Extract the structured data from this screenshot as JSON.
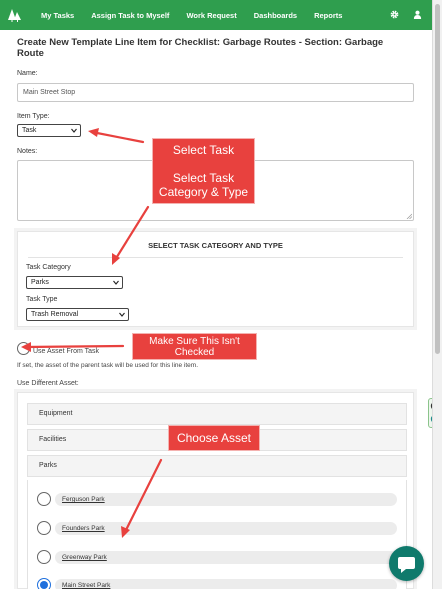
{
  "nav": {
    "links": [
      "My Tasks",
      "Assign Task to Myself",
      "Work Request",
      "Dashboards",
      "Reports"
    ],
    "accent": "#2f9e4e"
  },
  "page": {
    "title": "Create New Template Line Item for Checklist: Garbage Routes - Section: Garbage Route"
  },
  "form": {
    "name_label": "Name:",
    "name_value": "Main Street Stop",
    "item_type_label": "Item Type:",
    "item_type_value": "Task",
    "notes_label": "Notes:",
    "panel_title": "SELECT TASK CATEGORY AND TYPE",
    "task_category_label": "Task Category",
    "task_category_value": "Parks",
    "task_type_label": "Task Type",
    "task_type_value": "Trash Removal",
    "use_asset_label": "Use Asset From Task",
    "use_asset_checked": false,
    "use_asset_help": "If set, the asset of the parent task will be used for this line item.",
    "different_asset_label": "Use Different Asset:"
  },
  "assets": {
    "categories": [
      "Equipment",
      "Facilities",
      "Parks"
    ],
    "parks": [
      {
        "name": "Ferguson Park",
        "selected": false
      },
      {
        "name": "Founders Park",
        "selected": false
      },
      {
        "name": "Greenway Park",
        "selected": false
      },
      {
        "name": "Main Street Park",
        "selected": true
      }
    ]
  },
  "annotations": {
    "select_task": "Select Task",
    "select_category": "Select Task Category & Type",
    "make_sure": "Make Sure This Isn't Checked",
    "choose_asset": "Choose Asset",
    "color": "#e8413e"
  },
  "icons": {
    "logo": "trees-logo-icon",
    "settings": "gear-icon",
    "user": "user-icon",
    "chat": "chat-icon"
  }
}
